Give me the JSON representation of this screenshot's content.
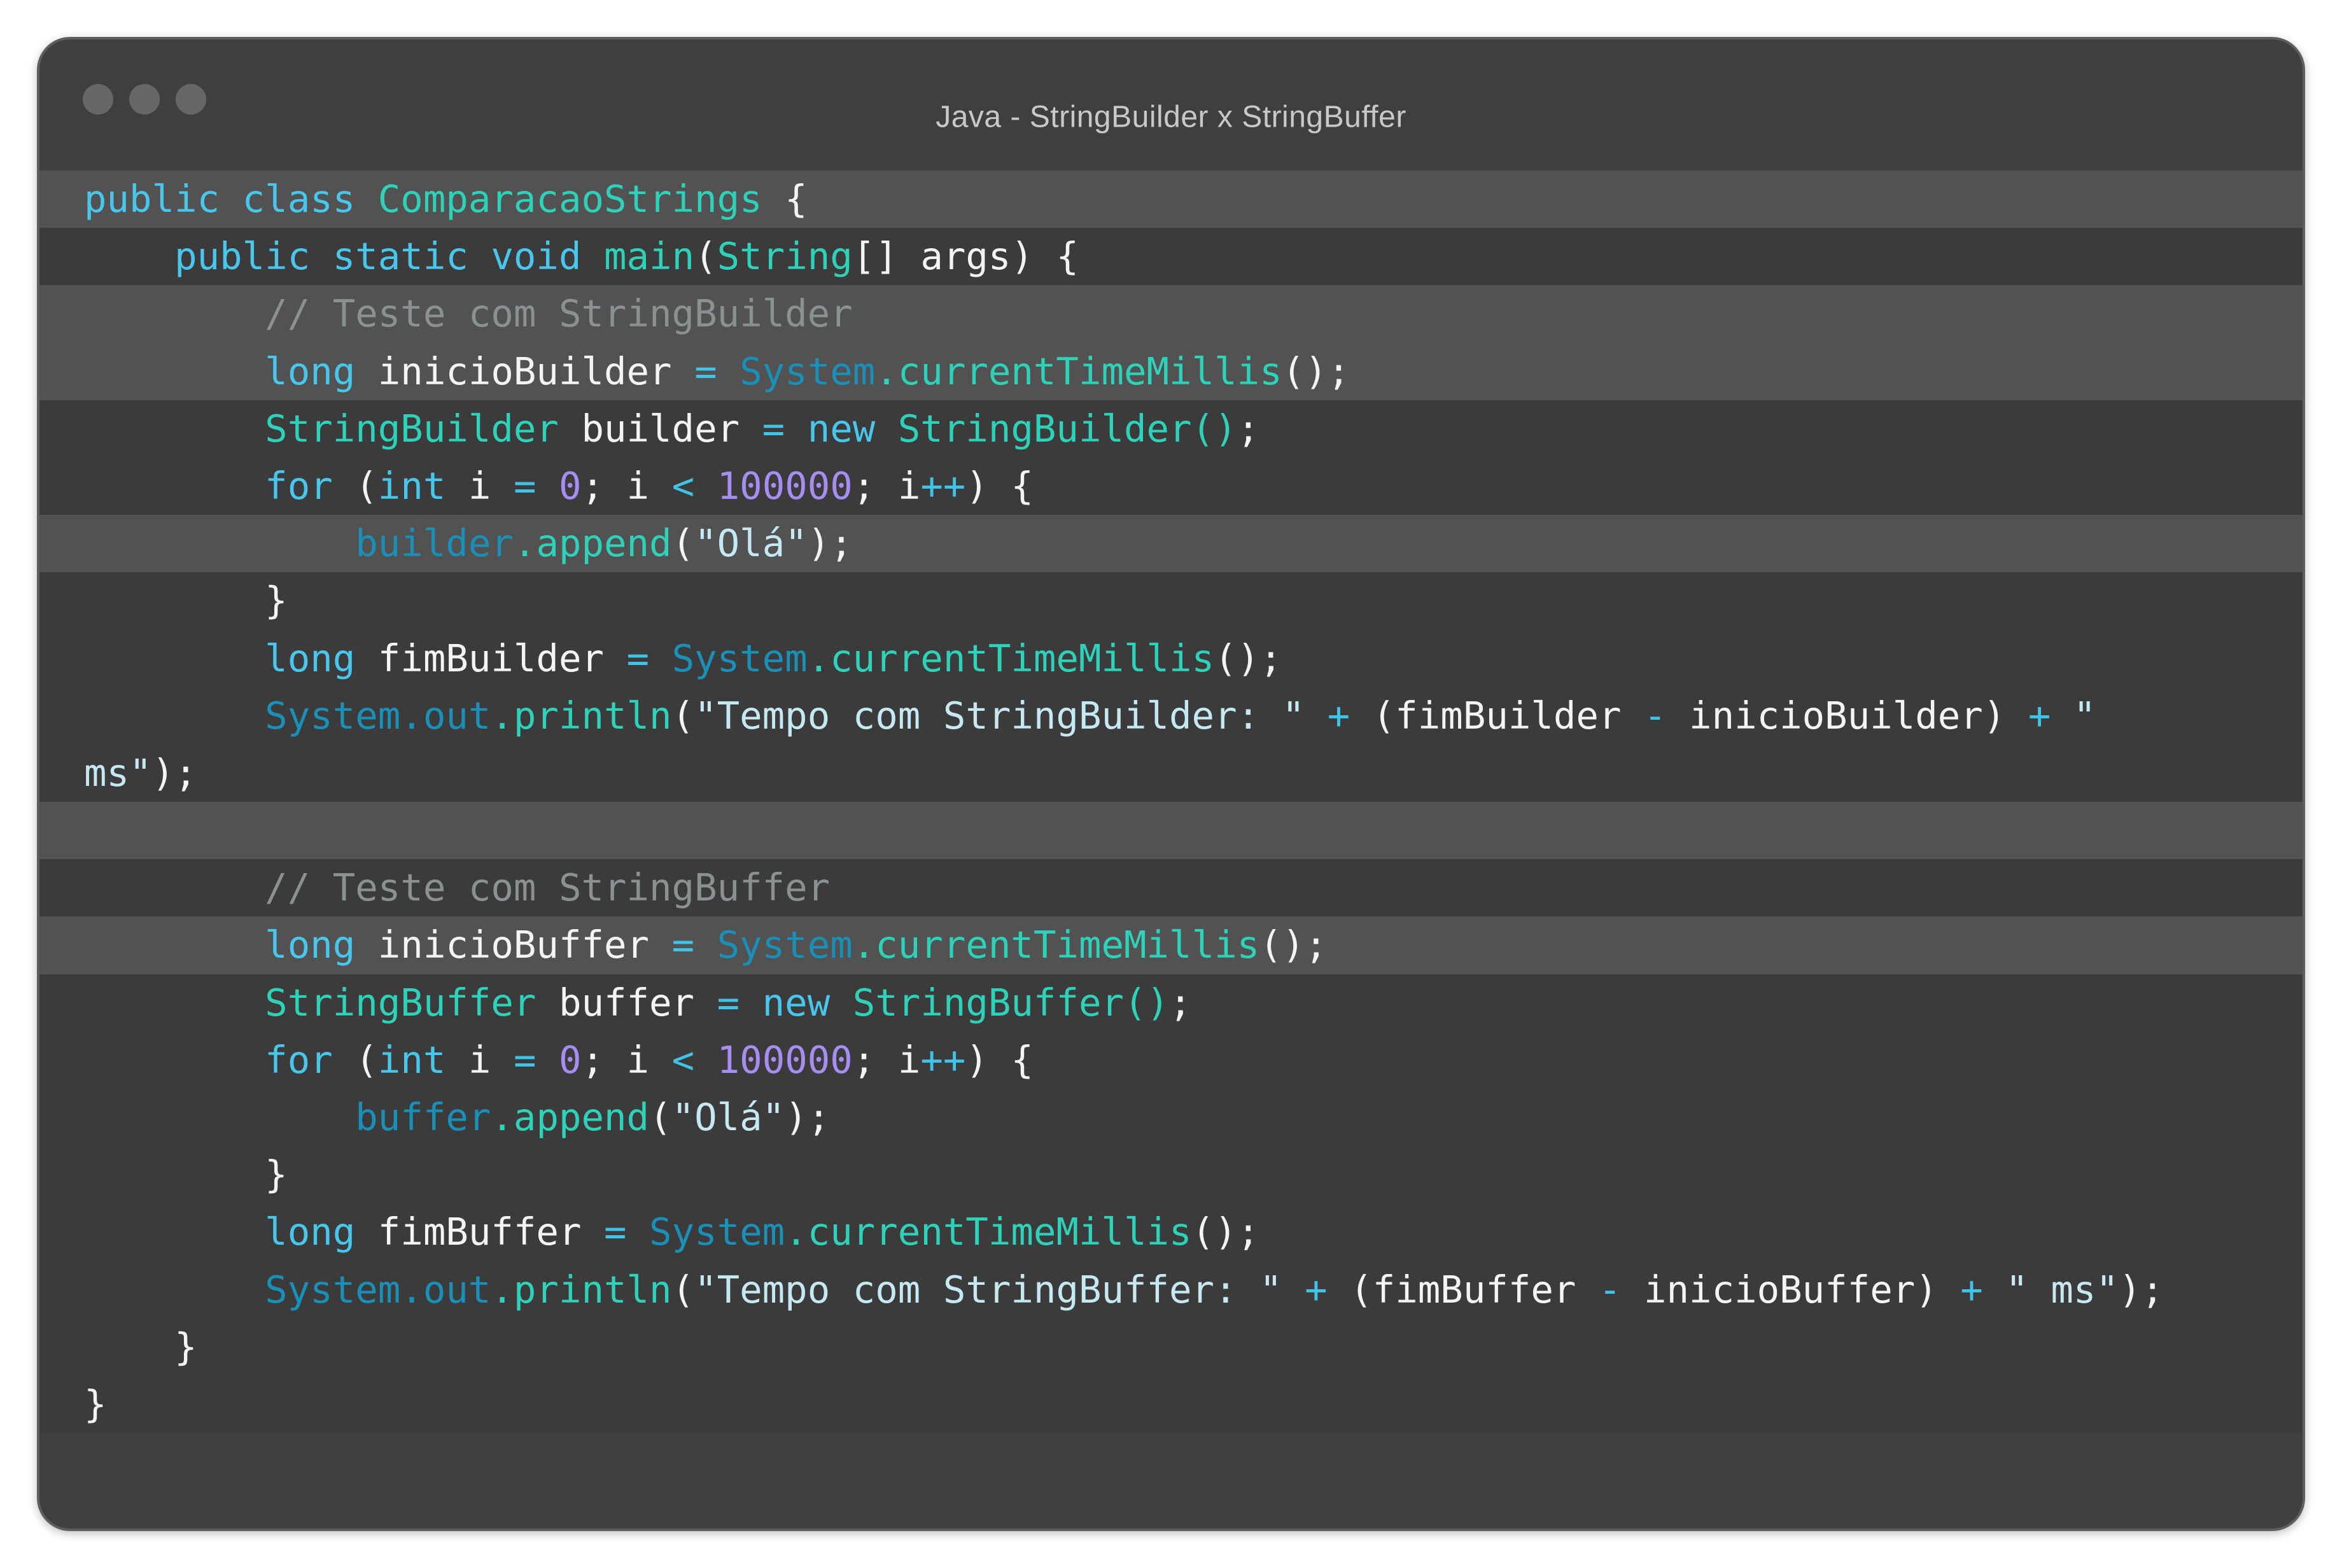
{
  "window": {
    "title": "Java - StringBuilder x StringBuffer"
  },
  "colors": {
    "window_bg": "#3f3f3f",
    "highlight_row": "#525252",
    "keyword": "#49c6ec",
    "class_name": "#2ed1b9",
    "object": "#1a8fb8",
    "number": "#a68ef1",
    "comment": "#8a9193"
  },
  "code": {
    "language": "Java",
    "lines": [
      {
        "hl": true,
        "tokens": [
          [
            "kw",
            "public class "
          ],
          [
            "cls",
            "ComparacaoStrings"
          ],
          [
            "txt",
            " {"
          ]
        ]
      },
      {
        "hl": false,
        "tokens": [
          [
            "txt",
            "    "
          ],
          [
            "kw",
            "public static void "
          ],
          [
            "fn",
            "main"
          ],
          [
            "txt",
            "("
          ],
          [
            "cls",
            "String"
          ],
          [
            "txt",
            "[] args) {"
          ]
        ]
      },
      {
        "hl": true,
        "tokens": [
          [
            "txt",
            "        "
          ],
          [
            "cmt",
            "// Teste com StringBuilder"
          ]
        ]
      },
      {
        "hl": true,
        "tokens": [
          [
            "txt",
            "        "
          ],
          [
            "kw",
            "long "
          ],
          [
            "txt",
            "inicioBuilder "
          ],
          [
            "op",
            "= "
          ],
          [
            "obj",
            "System"
          ],
          [
            "fn",
            ".currentTimeMillis"
          ],
          [
            "txt",
            "();"
          ]
        ]
      },
      {
        "hl": false,
        "tokens": [
          [
            "txt",
            "        "
          ],
          [
            "cls",
            "StringBuilder "
          ],
          [
            "txt",
            "builder "
          ],
          [
            "op",
            "= "
          ],
          [
            "kw",
            "new "
          ],
          [
            "cls",
            "StringBuilder()"
          ],
          [
            "txt",
            ";"
          ]
        ]
      },
      {
        "hl": false,
        "tokens": [
          [
            "txt",
            "        "
          ],
          [
            "kw",
            "for "
          ],
          [
            "txt",
            "("
          ],
          [
            "kw",
            "int "
          ],
          [
            "txt",
            "i "
          ],
          [
            "op",
            "= "
          ],
          [
            "num",
            "0"
          ],
          [
            "txt",
            "; i "
          ],
          [
            "op",
            "< "
          ],
          [
            "num",
            "100000"
          ],
          [
            "txt",
            "; i"
          ],
          [
            "op",
            "++"
          ],
          [
            "txt",
            ") {"
          ]
        ]
      },
      {
        "hl": true,
        "tokens": [
          [
            "txt",
            "            "
          ],
          [
            "obj",
            "builder"
          ],
          [
            "fn",
            ".append"
          ],
          [
            "txt",
            "("
          ],
          [
            "str",
            "\"Olá\""
          ],
          [
            "txt",
            ");"
          ]
        ]
      },
      {
        "hl": false,
        "tokens": [
          [
            "txt",
            "        }"
          ]
        ]
      },
      {
        "hl": false,
        "tokens": [
          [
            "txt",
            "        "
          ],
          [
            "kw",
            "long "
          ],
          [
            "txt",
            "fimBuilder "
          ],
          [
            "op",
            "= "
          ],
          [
            "obj",
            "System"
          ],
          [
            "fn",
            ".currentTimeMillis"
          ],
          [
            "txt",
            "();"
          ]
        ]
      },
      {
        "hl": false,
        "tokens": [
          [
            "txt",
            "        "
          ],
          [
            "obj",
            "System.out"
          ],
          [
            "fn",
            ".println"
          ],
          [
            "txt",
            "("
          ],
          [
            "str",
            "\"Tempo com StringBuilder: \" "
          ],
          [
            "op",
            "+ "
          ],
          [
            "txt",
            "(fimBuilder "
          ],
          [
            "op",
            "- "
          ],
          [
            "txt",
            "inicioBuilder) "
          ],
          [
            "op",
            "+ "
          ],
          [
            "str",
            "\""
          ]
        ]
      },
      {
        "hl": false,
        "tokens": [
          [
            "str",
            "ms\""
          ],
          [
            "txt",
            ");"
          ]
        ]
      },
      {
        "hl": true,
        "tokens": []
      },
      {
        "hl": false,
        "tokens": [
          [
            "txt",
            "        "
          ],
          [
            "cmt",
            "// Teste com StringBuffer"
          ]
        ]
      },
      {
        "hl": true,
        "tokens": [
          [
            "txt",
            "        "
          ],
          [
            "kw",
            "long "
          ],
          [
            "txt",
            "inicioBuffer "
          ],
          [
            "op",
            "= "
          ],
          [
            "obj",
            "System"
          ],
          [
            "fn",
            ".currentTimeMillis"
          ],
          [
            "txt",
            "();"
          ]
        ]
      },
      {
        "hl": false,
        "tokens": [
          [
            "txt",
            "        "
          ],
          [
            "cls",
            "StringBuffer "
          ],
          [
            "txt",
            "buffer "
          ],
          [
            "op",
            "= "
          ],
          [
            "kw",
            "new "
          ],
          [
            "cls",
            "StringBuffer()"
          ],
          [
            "txt",
            ";"
          ]
        ]
      },
      {
        "hl": false,
        "tokens": [
          [
            "txt",
            "        "
          ],
          [
            "kw",
            "for "
          ],
          [
            "txt",
            "("
          ],
          [
            "kw",
            "int "
          ],
          [
            "txt",
            "i "
          ],
          [
            "op",
            "= "
          ],
          [
            "num",
            "0"
          ],
          [
            "txt",
            "; i "
          ],
          [
            "op",
            "< "
          ],
          [
            "num",
            "100000"
          ],
          [
            "txt",
            "; i"
          ],
          [
            "op",
            "++"
          ],
          [
            "txt",
            ") {"
          ]
        ]
      },
      {
        "hl": false,
        "tokens": [
          [
            "txt",
            "            "
          ],
          [
            "obj",
            "buffer"
          ],
          [
            "fn",
            ".append"
          ],
          [
            "txt",
            "("
          ],
          [
            "str",
            "\"Olá\""
          ],
          [
            "txt",
            ");"
          ]
        ]
      },
      {
        "hl": false,
        "tokens": [
          [
            "txt",
            "        }"
          ]
        ]
      },
      {
        "hl": false,
        "tokens": [
          [
            "txt",
            "        "
          ],
          [
            "kw",
            "long "
          ],
          [
            "txt",
            "fimBuffer "
          ],
          [
            "op",
            "= "
          ],
          [
            "obj",
            "System"
          ],
          [
            "fn",
            ".currentTimeMillis"
          ],
          [
            "txt",
            "();"
          ]
        ]
      },
      {
        "hl": false,
        "tokens": [
          [
            "txt",
            "        "
          ],
          [
            "obj",
            "System.out"
          ],
          [
            "fn",
            ".println"
          ],
          [
            "txt",
            "("
          ],
          [
            "str",
            "\"Tempo com StringBuffer: \" "
          ],
          [
            "op",
            "+ "
          ],
          [
            "txt",
            "(fimBuffer "
          ],
          [
            "op",
            "- "
          ],
          [
            "txt",
            "inicioBuffer) "
          ],
          [
            "op",
            "+ "
          ],
          [
            "str",
            "\" ms\""
          ],
          [
            "txt",
            ");"
          ]
        ]
      },
      {
        "hl": false,
        "tokens": [
          [
            "txt",
            "    }"
          ]
        ]
      },
      {
        "hl": false,
        "tokens": [
          [
            "txt",
            "}"
          ]
        ]
      }
    ]
  }
}
